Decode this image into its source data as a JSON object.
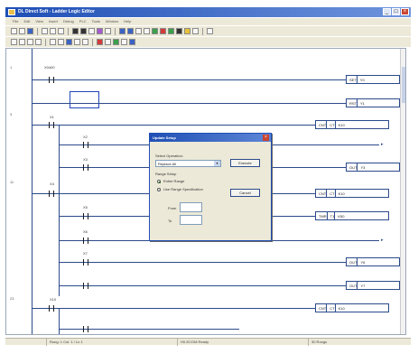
{
  "window": {
    "title": "DL Direct Soft - Ladder Logic Editor"
  },
  "menu": [
    "File",
    "Edit",
    "View",
    "Insert",
    "Debug",
    "PLC",
    "Tools",
    "Window",
    "Help"
  ],
  "rungs": [
    {
      "number": "1",
      "contact": "X0400",
      "coil": [
        "SET",
        "Y0"
      ]
    },
    {
      "number": "",
      "contact": "",
      "coil": [
        "RST",
        "Y1"
      ]
    },
    {
      "number": "3",
      "contact": "X1",
      "coil": [
        "CNT",
        "CT",
        "K10"
      ]
    },
    {
      "number": "",
      "contact": "X2",
      "coil": [
        "OUT",
        "Y2"
      ]
    },
    {
      "number": "",
      "contact": "X3",
      "coil": [
        "OUT",
        "Y3"
      ]
    },
    {
      "number": "11",
      "contact": "X4",
      "coil": [
        "CNT",
        "CT",
        "K10"
      ]
    },
    {
      "number": "",
      "contact": "X5",
      "coil": [
        "TMR",
        "T1",
        "K50"
      ]
    },
    {
      "number": "",
      "contact": "X6",
      "coil": [
        "OUT",
        "Y5"
      ]
    },
    {
      "number": "",
      "contact": "X7",
      "coil": [
        "OUT",
        "Y6"
      ]
    },
    {
      "number": "23",
      "contact": "X10",
      "coil": [
        "CNT",
        "CT",
        "K10"
      ]
    }
  ],
  "dialog": {
    "title": "Update Setup",
    "select_label": "Select Operation:",
    "select_value": "Replace All",
    "group_label": "Range Setup",
    "radio_entire": "Entire Range",
    "radio_specific": "Use Range Specification",
    "from_label": "From",
    "to_label": "To",
    "execute_label": "Execute",
    "cancel_label": "Cancel"
  },
  "status": {
    "position": "Rung: 1 Col: 1 / Ln 1",
    "plc": "H0-ECOM Ready",
    "zoom": "30 Rungs"
  }
}
